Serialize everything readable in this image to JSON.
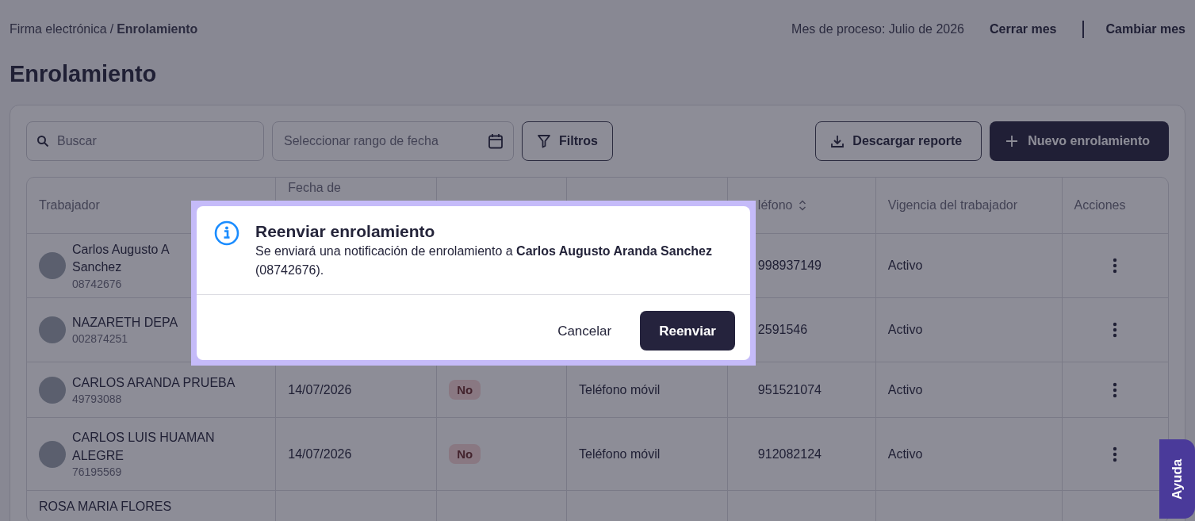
{
  "breadcrumb": {
    "parent": "Firma electrónica",
    "separator": "/",
    "current": "Enrolamiento"
  },
  "header_actions": {
    "period": "Mes de proceso: Julio de 2026",
    "close_month": "Cerrar mes",
    "change_month": "Cambiar mes"
  },
  "title": "Enrolamiento",
  "toolbar": {
    "search": {
      "placeholder": "Buscar"
    },
    "date_range": {
      "placeholder": "Seleccionar rango de fecha"
    },
    "filters": "Filtros",
    "download": "Descargar reporte",
    "new": "Nuevo enrolamiento"
  },
  "table": {
    "columns": [
      {
        "label": "Trabajador"
      },
      {
        "label": "Fecha de"
      },
      {},
      {},
      {
        "label": "léfono",
        "sortable": true
      },
      {
        "label": "Vigencia del trabajador"
      },
      {
        "label": "Acciones"
      }
    ],
    "rows": [
      {
        "name": "Carlos Augusto A\nSanchez",
        "id": "08742676",
        "phone": "998937149",
        "status": "Activo"
      },
      {
        "name": "NAZARETH DEPA",
        "id": "002874251",
        "phone": "2591546",
        "status": "Activo"
      },
      {
        "name": "CARLOS ARANDA PRUEBA",
        "id": "49793088",
        "date": "14/07/2026",
        "badge": "No",
        "channel": "Teléfono móvil",
        "phone": "951521074",
        "status": "Activo"
      },
      {
        "name": "CARLOS LUIS HUAMAN ALEGRE",
        "id": "76195569",
        "date": "14/07/2026",
        "badge": "No",
        "channel": "Teléfono móvil",
        "phone": "912082124",
        "status": "Activo"
      },
      {
        "name": "ROSA MARIA FLORES"
      }
    ]
  },
  "dialog": {
    "title": "Reenviar enrolamiento",
    "message": "Se enviará una notificación de enrolamiento a **Carlos Augusto Aranda Sanchez** (08742676).",
    "cancel": "Cancelar",
    "confirm": "Reenviar"
  },
  "help_tab": "Ayuda"
}
